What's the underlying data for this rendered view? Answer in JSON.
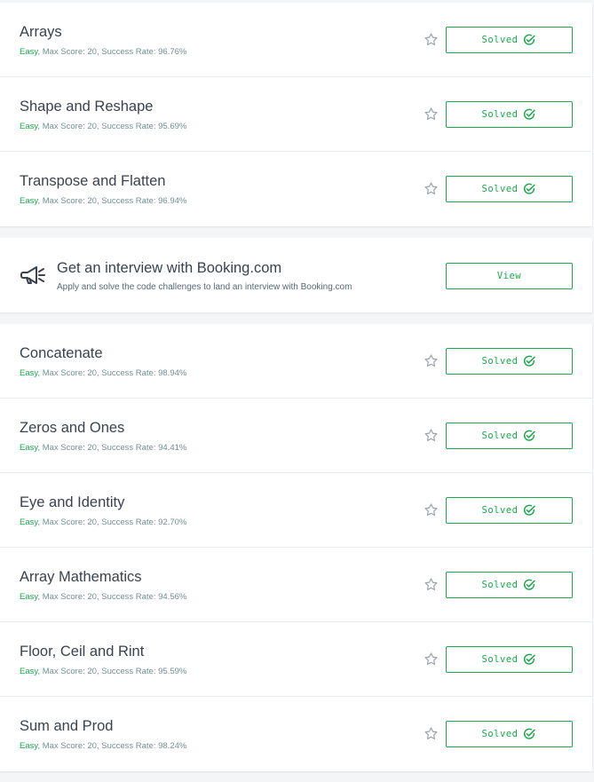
{
  "colors": {
    "accent": "#1ba94c",
    "title_text": "#39424e",
    "meta_text": "#738f93",
    "background": "#f3f5f7"
  },
  "challenges_top": [
    {
      "title": "Arrays",
      "difficulty": "Easy",
      "stats": ", Max Score: 20, Success Rate: 96.76%",
      "status": "Solved"
    },
    {
      "title": "Shape and Reshape",
      "difficulty": "Easy",
      "stats": ", Max Score: 20, Success Rate: 95.69%",
      "status": "Solved"
    },
    {
      "title": "Transpose and Flatten",
      "difficulty": "Easy",
      "stats": ", Max Score: 20, Success Rate: 96.94%",
      "status": "Solved"
    }
  ],
  "promo": {
    "icon": "megaphone-icon",
    "title": "Get an interview with Booking.com",
    "subtitle": "Apply and solve the code challenges to land an interview with Booking.com",
    "button_label": "View"
  },
  "challenges_bottom": [
    {
      "title": "Concatenate",
      "difficulty": "Easy",
      "stats": ", Max Score: 20, Success Rate: 98.94%",
      "status": "Solved"
    },
    {
      "title": "Zeros and Ones",
      "difficulty": "Easy",
      "stats": ", Max Score: 20, Success Rate: 94.41%",
      "status": "Solved"
    },
    {
      "title": "Eye and Identity",
      "difficulty": "Easy",
      "stats": ", Max Score: 20, Success Rate: 92.70%",
      "status": "Solved"
    },
    {
      "title": "Array Mathematics",
      "difficulty": "Easy",
      "stats": ", Max Score: 20, Success Rate: 94.56%",
      "status": "Solved"
    },
    {
      "title": "Floor, Ceil and Rint",
      "difficulty": "Easy",
      "stats": ", Max Score: 20, Success Rate: 95.59%",
      "status": "Solved"
    },
    {
      "title": "Sum and Prod",
      "difficulty": "Easy",
      "stats": ", Max Score: 20, Success Rate: 98.24%",
      "status": "Solved"
    }
  ]
}
